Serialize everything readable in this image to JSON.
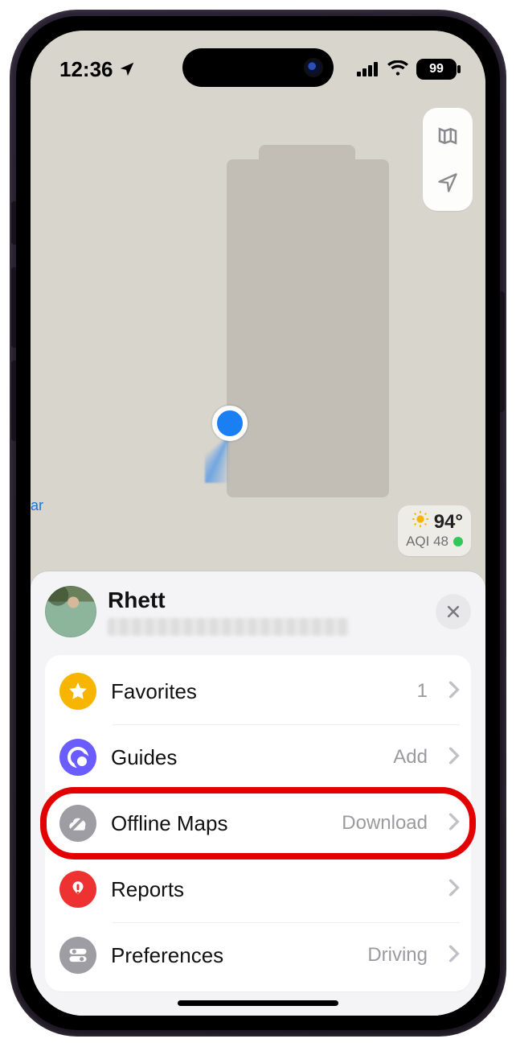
{
  "status": {
    "time": "12:36",
    "battery": "99"
  },
  "weather": {
    "temp": "94°",
    "aqi_label": "AQI 48"
  },
  "map": {
    "poi_label": "ar"
  },
  "sheet": {
    "name": "Rhett",
    "items": [
      {
        "id": "favorites",
        "label": "Favorites",
        "value": "1"
      },
      {
        "id": "guides",
        "label": "Guides",
        "value": "Add"
      },
      {
        "id": "offline",
        "label": "Offline Maps",
        "value": "Download"
      },
      {
        "id": "reports",
        "label": "Reports",
        "value": ""
      },
      {
        "id": "preferences",
        "label": "Preferences",
        "value": "Driving"
      }
    ]
  },
  "highlight_index": 2
}
